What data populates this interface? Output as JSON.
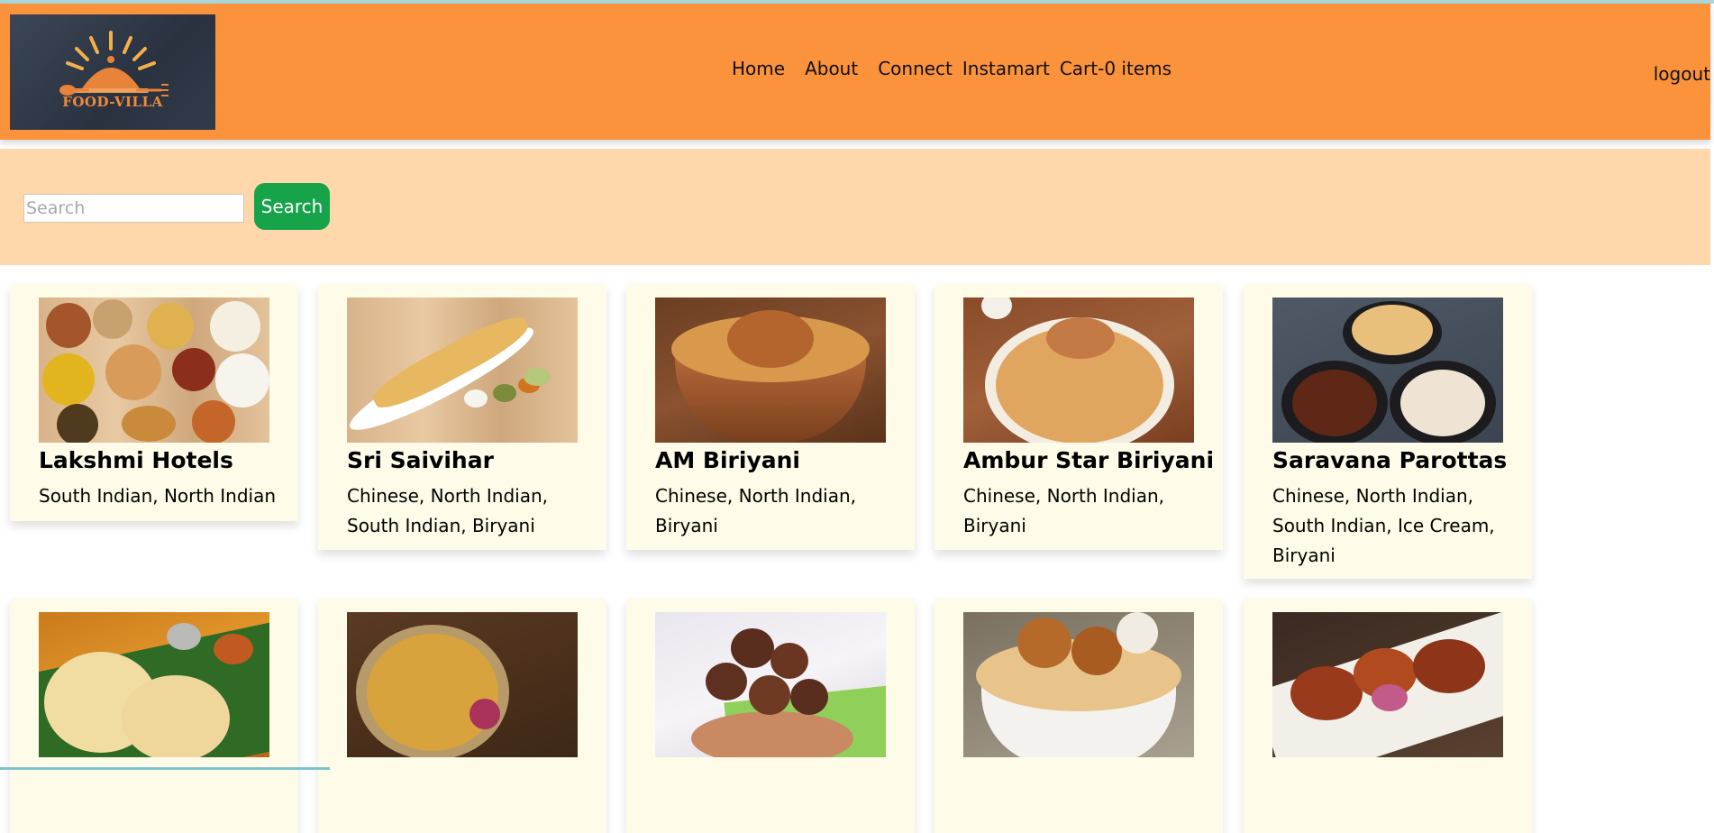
{
  "header": {
    "logo_text": "FOOD-VILLA",
    "nav": [
      "Home",
      "About",
      "Connect",
      "Instamart",
      "Cart-0 items"
    ],
    "logout_label": "logout"
  },
  "search": {
    "placeholder": "Search",
    "value": "",
    "button_label": "Search"
  },
  "restaurants": [
    {
      "name": "Lakshmi Hotels",
      "cuisines": "South Indian, North Indian",
      "image": "thali-platter"
    },
    {
      "name": "Sri Saivihar",
      "cuisines": "Chinese, North Indian, South Indian, Biryani",
      "image": "dosa"
    },
    {
      "name": "AM Biriyani",
      "cuisines": "Chinese, North Indian, Biryani",
      "image": "biryani-copper-pot"
    },
    {
      "name": "Ambur Star Biriyani",
      "cuisines": "Chinese, North Indian, Biryani",
      "image": "biryani-plate"
    },
    {
      "name": "Saravana Parottas",
      "cuisines": "Chinese, North Indian, South Indian, Ice Cream, Biryani",
      "image": "parotta-curry"
    },
    {
      "name": "",
      "cuisines": "",
      "image": "parotta-on-leaf"
    },
    {
      "name": "",
      "cuisines": "",
      "image": "biryani-platter"
    },
    {
      "name": "",
      "cuisines": "",
      "image": "fried-balls"
    },
    {
      "name": "",
      "cuisines": "",
      "image": "biryani-bowl"
    },
    {
      "name": "",
      "cuisines": "",
      "image": "tandoori-chicken"
    }
  ],
  "colors": {
    "header_bg": "#fb923c",
    "search_bg": "#fed7aa",
    "search_button": "#16a34a",
    "card_bg": "#fefce8"
  }
}
